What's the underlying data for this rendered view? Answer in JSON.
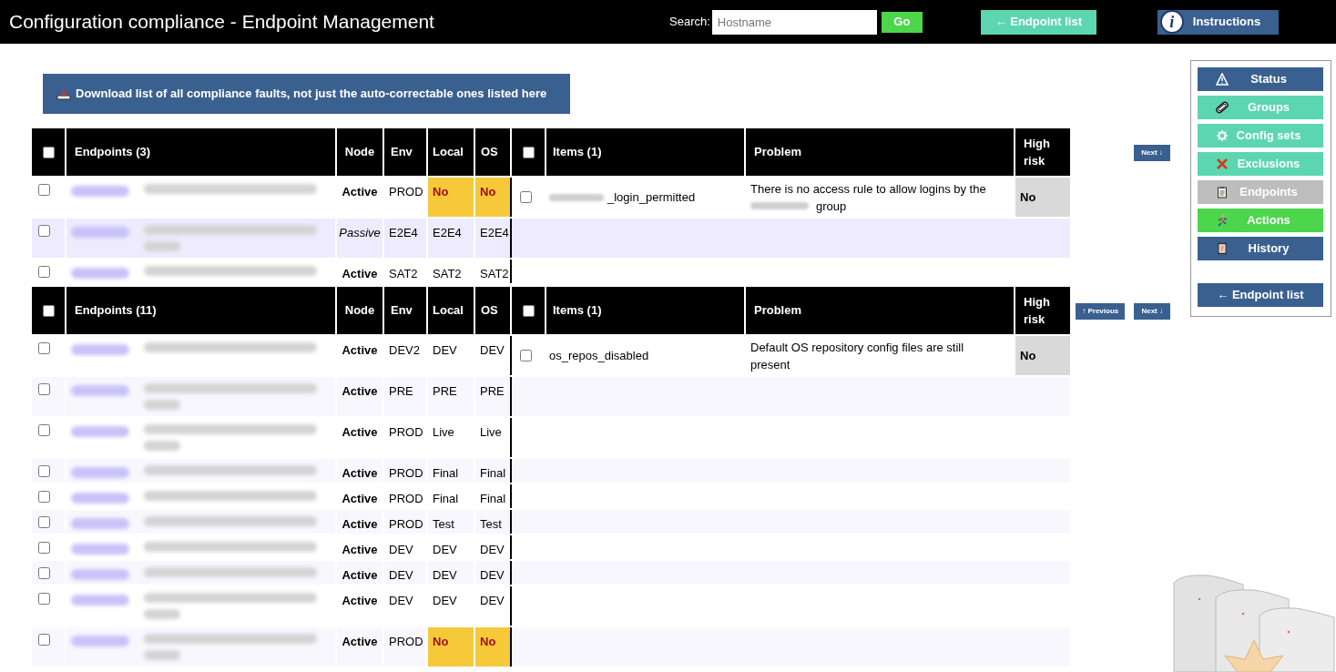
{
  "header": {
    "title": "Configuration compliance - Endpoint Management",
    "search_label": "Search:",
    "search_placeholder": "Hostname",
    "go_button": "Go",
    "endpoint_list_button": "← Endpoint list",
    "instructions_icon": "i",
    "instructions_button": "Instructions"
  },
  "download_button": "Download list of all compliance faults, not just the auto-correctable ones listed here",
  "sections": [
    {
      "columns": {
        "endpoints": "Endpoints (3)",
        "node": "Node",
        "env": "Env",
        "local": "Local",
        "os": "OS",
        "items": "Items (1)",
        "problem": "Problem",
        "high_risk": "High risk"
      },
      "header_checked": false,
      "items_header_checked": false,
      "pagination": [
        {
          "kind": "next",
          "label": "Next ↓"
        }
      ],
      "rows": [
        {
          "checked": false,
          "description_wraps": false,
          "node": "Active",
          "node_italic": false,
          "env": "PROD",
          "local": "No",
          "local_flagged": true,
          "os": "No",
          "os_flagged": true
        },
        {
          "checked": false,
          "description_wraps": true,
          "node": "Passive",
          "node_italic": true,
          "env": "E2E4",
          "local": "E2E4",
          "local_flagged": false,
          "os": "E2E4",
          "os_flagged": false
        },
        {
          "checked": false,
          "description_wraps": false,
          "node": "Active",
          "node_italic": false,
          "env": "SAT2",
          "local": "SAT2",
          "local_flagged": false,
          "os": "SAT2",
          "os_flagged": false
        }
      ],
      "items": [
        {
          "checked": false,
          "name_prefix_blurred": true,
          "name": "_login_permitted",
          "problem": [
            "There is no access rule to allow logins by the",
            "group"
          ],
          "high_risk": "No"
        }
      ]
    },
    {
      "columns": {
        "endpoints": "Endpoints (11)",
        "node": "Node",
        "env": "Env",
        "local": "Local",
        "os": "OS",
        "items": "Items (1)",
        "problem": "Problem",
        "high_risk": "High risk"
      },
      "header_checked": false,
      "items_header_checked": false,
      "pagination": [
        {
          "kind": "previous",
          "label": "↑ Previous"
        },
        {
          "kind": "next",
          "label": "Next ↓"
        }
      ],
      "rows": [
        {
          "checked": false,
          "description_wraps": false,
          "node": "Active",
          "node_italic": false,
          "env": "DEV2",
          "local": "DEV",
          "local_flagged": false,
          "os": "DEV",
          "os_flagged": false
        },
        {
          "checked": false,
          "description_wraps": true,
          "node": "Active",
          "node_italic": false,
          "env": "PRE",
          "local": "PRE",
          "local_flagged": false,
          "os": "PRE",
          "os_flagged": false
        },
        {
          "checked": false,
          "description_wraps": true,
          "node": "Active",
          "node_italic": false,
          "env": "PROD",
          "local": "Live",
          "local_flagged": false,
          "os": "Live",
          "os_flagged": false
        },
        {
          "checked": false,
          "description_wraps": false,
          "node": "Active",
          "node_italic": false,
          "env": "PROD",
          "local": "Final",
          "local_flagged": false,
          "os": "Final",
          "os_flagged": false
        },
        {
          "checked": false,
          "description_wraps": false,
          "node": "Active",
          "node_italic": false,
          "env": "PROD",
          "local": "Final",
          "local_flagged": false,
          "os": "Final",
          "os_flagged": false
        },
        {
          "checked": false,
          "description_wraps": false,
          "node": "Active",
          "node_italic": false,
          "env": "PROD",
          "local": "Test",
          "local_flagged": false,
          "os": "Test",
          "os_flagged": false
        },
        {
          "checked": false,
          "description_wraps": false,
          "node": "Active",
          "node_italic": false,
          "env": "DEV",
          "local": "DEV",
          "local_flagged": false,
          "os": "DEV",
          "os_flagged": false
        },
        {
          "checked": false,
          "description_wraps": false,
          "node": "Active",
          "node_italic": false,
          "env": "DEV",
          "local": "DEV",
          "local_flagged": false,
          "os": "DEV",
          "os_flagged": false
        },
        {
          "checked": false,
          "description_wraps": true,
          "node": "Active",
          "node_italic": false,
          "env": "DEV",
          "local": "DEV",
          "local_flagged": false,
          "os": "DEV",
          "os_flagged": false
        },
        {
          "checked": false,
          "description_wraps": true,
          "node": "Active",
          "node_italic": false,
          "env": "PROD",
          "local": "No",
          "local_flagged": true,
          "os": "No",
          "os_flagged": true
        }
      ],
      "items": [
        {
          "checked": false,
          "name_prefix_blurred": false,
          "name": "os_repos_disabled",
          "problem": [
            "Default OS repository config files are still present"
          ],
          "high_risk": "No"
        }
      ]
    }
  ],
  "sidebar": [
    {
      "kind": "status",
      "label": "Status"
    },
    {
      "kind": "groups",
      "label": "Groups"
    },
    {
      "kind": "config",
      "label": "Config sets"
    },
    {
      "kind": "exclusions",
      "label": "Exclusions"
    },
    {
      "kind": "endpoints",
      "label": "Endpoints"
    },
    {
      "kind": "actions",
      "label": "Actions"
    },
    {
      "kind": "history",
      "label": "History"
    },
    {
      "kind": "back",
      "label": "← Endpoint list"
    }
  ]
}
